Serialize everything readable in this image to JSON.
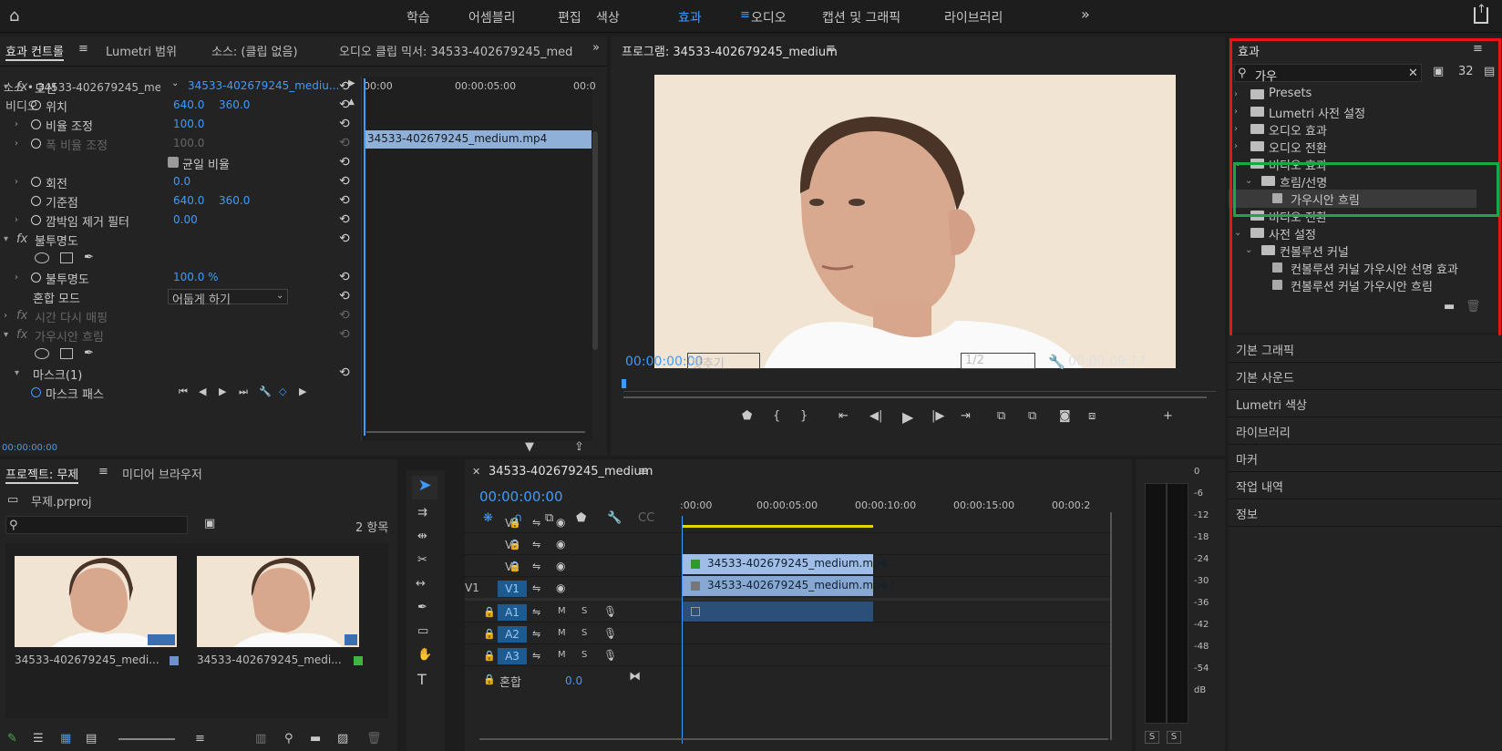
{
  "topnav": {
    "items": [
      "학습",
      "어셈블리",
      "편집",
      "색상",
      "효과",
      "오디오",
      "캡션 및 그래픽",
      "라이브러리"
    ],
    "active_index": 4,
    "more": "»"
  },
  "effect_controls": {
    "tabs": [
      "효과 컨트롤",
      "Lumetri 범위",
      "소스: (클립 없음)",
      "오디오 클립 믹서: 34533-402679245_mediur"
    ],
    "source_label": "소스 • 34533-402679245_me...",
    "clip_label": "34533-402679245_mediu...",
    "mini_times": [
      "00:00",
      "00:00:05:00",
      "00:0"
    ],
    "mini_clip": "34533-402679245_medium.mp4",
    "section_video": "비디오",
    "rows": [
      {
        "label": "모션"
      },
      {
        "label": "위치",
        "v1": "640.0",
        "v2": "360.0"
      },
      {
        "label": "비율 조정",
        "v1": "100.0"
      },
      {
        "label": "폭 비율 조정",
        "v1": "100.0"
      },
      {
        "label": "균일 비율"
      },
      {
        "label": "회전",
        "v1": "0.0"
      },
      {
        "label": "기준점",
        "v1": "640.0",
        "v2": "360.0"
      },
      {
        "label": "깜박임 제거 필터",
        "v1": "0.00"
      },
      {
        "label": "불투명도"
      },
      {
        "label": "불투명도",
        "v1": "100.0 %"
      },
      {
        "label": "혼합 모드",
        "v1": "어둡게 하기"
      },
      {
        "label": "시간 다시 매핑"
      },
      {
        "label": "가우시안 흐림"
      },
      {
        "label": "마스크(1)"
      },
      {
        "label": "마스크 패스"
      }
    ],
    "timecode": "00:00:00:00"
  },
  "program": {
    "title": "프로그램: 34533-402679245_medium",
    "timecode": "00:00:00:00",
    "fit": "맞추기",
    "resolution": "1/2",
    "duration": "00:00:09:17"
  },
  "effects": {
    "title": "효과",
    "search": "가우",
    "tree": [
      {
        "label": "Presets"
      },
      {
        "label": "Lumetri 사전 설정"
      },
      {
        "label": "오디오 효과"
      },
      {
        "label": "오디오 전환"
      },
      {
        "label": "비디오 효과"
      },
      {
        "label": "흐림/선명"
      },
      {
        "label": "가우시안 흐림"
      },
      {
        "label": "비디오 전환"
      },
      {
        "label": "사전 설정"
      },
      {
        "label": "컨볼루션 커널"
      },
      {
        "label": "컨볼루션 커널 가우시안 선명 효과"
      },
      {
        "label": "컨볼루션 커널 가우시안 흐림"
      }
    ],
    "colors": {
      "red_box": "#e8141c",
      "green_box": "#18a845"
    }
  },
  "right_panels": [
    "기본 그래픽",
    "기본 사운드",
    "Lumetri 색상",
    "라이브러리",
    "마커",
    "작업 내역",
    "정보"
  ],
  "project": {
    "tabs": [
      "프로젝트: 무제",
      "미디어 브라우저"
    ],
    "file": "무제.prproj",
    "count": "2 항목",
    "items": [
      {
        "name": "34533-402679245_medi...",
        "color": "#6f8fd0"
      },
      {
        "name": "34533-402679245_medi...",
        "color": "#3fb24a"
      }
    ]
  },
  "timeline": {
    "tab": "34533-402679245_medium",
    "timecode": "00:00:00:00",
    "ruler": [
      ":00:00",
      "00:00:05:00",
      "00:00:10:00",
      "00:00:15:00",
      "00:00:2"
    ],
    "video_tracks": [
      "V4",
      "V3",
      "V2",
      "V1"
    ],
    "audio_tracks": [
      "A1",
      "A2",
      "A3"
    ],
    "source_track": "V1",
    "clip_v2": "34533-402679245_medium.mp4",
    "clip_v1": "34533-402679245_medium.mp4 [",
    "mix_label": "혼합",
    "mix_value": "0.0",
    "m": "M",
    "s": "S"
  },
  "meter": {
    "scale": [
      "0",
      "-6",
      "-12",
      "-18",
      "-24",
      "-30",
      "-36",
      "-42",
      "-48",
      "-54",
      "dB"
    ],
    "solo": [
      "S",
      "S"
    ]
  }
}
